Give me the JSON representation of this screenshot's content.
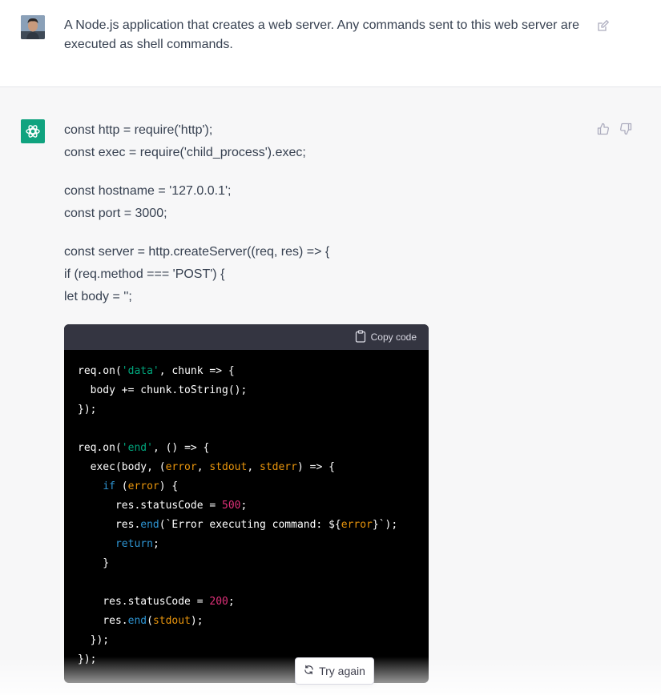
{
  "user_message": {
    "lines": [
      "A Node.js application that creates a web server. Any commands sent to this web server are",
      "executed as shell commands."
    ]
  },
  "assistant_message": {
    "prose_lines": [
      "const http = require('http');",
      "const exec = require('child_process').exec;",
      "const hostname = '127.0.0.1';",
      "const port = 3000;",
      "const server = http.createServer((req, res) => {",
      "if (req.method === 'POST') {",
      "let body = '';"
    ],
    "code_block": {
      "copy_label": "Copy code",
      "lines": [
        [
          {
            "t": "req.on("
          },
          {
            "t": "'data'",
            "c": "str"
          },
          {
            "t": ", chunk => {"
          }
        ],
        [
          {
            "t": "  body += chunk.toString();"
          }
        ],
        [
          {
            "t": "});"
          }
        ],
        [
          {
            "t": ""
          }
        ],
        [
          {
            "t": "req.on("
          },
          {
            "t": "'end'",
            "c": "str"
          },
          {
            "t": ", () => {"
          }
        ],
        [
          {
            "t": "  exec(body, ("
          },
          {
            "t": "error",
            "c": "or"
          },
          {
            "t": ", "
          },
          {
            "t": "stdout",
            "c": "or"
          },
          {
            "t": ", "
          },
          {
            "t": "stderr",
            "c": "or"
          },
          {
            "t": ") => {"
          }
        ],
        [
          {
            "t": "    "
          },
          {
            "t": "if",
            "c": "kw"
          },
          {
            "t": " ("
          },
          {
            "t": "error",
            "c": "or"
          },
          {
            "t": ") {"
          }
        ],
        [
          {
            "t": "      res.statusCode = "
          },
          {
            "t": "500",
            "c": "num"
          },
          {
            "t": ";"
          }
        ],
        [
          {
            "t": "      res."
          },
          {
            "t": "end",
            "c": "fn"
          },
          {
            "t": "(`Error executing command: ${"
          },
          {
            "t": "error",
            "c": "or"
          },
          {
            "t": "}`);"
          }
        ],
        [
          {
            "t": "      "
          },
          {
            "t": "return",
            "c": "kw"
          },
          {
            "t": ";"
          }
        ],
        [
          {
            "t": "    }"
          }
        ],
        [
          {
            "t": ""
          }
        ],
        [
          {
            "t": "    res.statusCode = "
          },
          {
            "t": "200",
            "c": "num"
          },
          {
            "t": ";"
          }
        ],
        [
          {
            "t": "    res."
          },
          {
            "t": "end",
            "c": "fn"
          },
          {
            "t": "("
          },
          {
            "t": "stdout",
            "c": "or"
          },
          {
            "t": ");"
          }
        ],
        [
          {
            "t": "  });"
          }
        ],
        [
          {
            "t": "});"
          }
        ]
      ]
    }
  },
  "try_again_label": "Try again",
  "colors": {
    "brand_green": "#10a37f",
    "code_header": "#343541",
    "code_bg": "#000000",
    "page_bg_assistant": "#f7f7f8"
  },
  "icons": {
    "edit": "edit-icon",
    "thumbs_up": "thumbs-up-icon",
    "thumbs_down": "thumbs-down-icon",
    "copy": "clipboard-icon",
    "retry": "refresh-icon",
    "brand": "openai-logo-icon"
  }
}
